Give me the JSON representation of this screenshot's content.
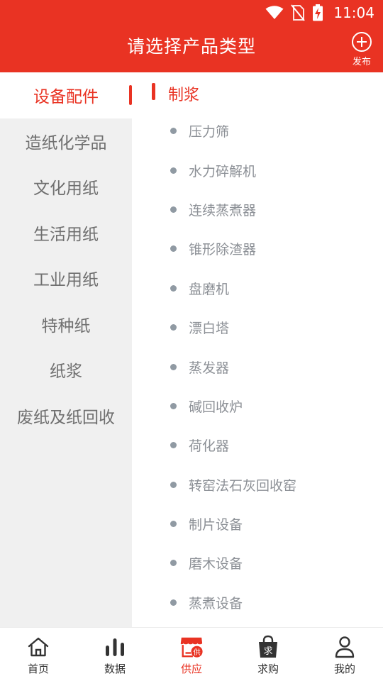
{
  "status_bar": {
    "time": "11:04"
  },
  "header": {
    "title": "请选择产品类型",
    "publish_label": "发布"
  },
  "categories": [
    {
      "label": "设备配件",
      "active": true
    },
    {
      "label": "造纸化学品"
    },
    {
      "label": "文化用纸"
    },
    {
      "label": "生活用纸"
    },
    {
      "label": "工业用纸"
    },
    {
      "label": "特种纸"
    },
    {
      "label": "纸浆"
    },
    {
      "label": "废纸及纸回收"
    }
  ],
  "section": {
    "title": "制浆",
    "items": [
      "压力筛",
      "水力碎解机",
      "连续蒸煮器",
      "锥形除渣器",
      "盘磨机",
      "漂白塔",
      "蒸发器",
      "碱回收炉",
      "荷化器",
      "转窑法石灰回收窑",
      "制片设备",
      "磨木设备",
      "蒸煮设备"
    ]
  },
  "bottom_nav": [
    {
      "label": "首页",
      "icon": "home-icon"
    },
    {
      "label": "数据",
      "icon": "bar-chart-icon"
    },
    {
      "label": "供应",
      "icon": "supply-store-icon",
      "badge": "供",
      "active": true
    },
    {
      "label": "求购",
      "icon": "purchase-bag-icon",
      "badge": "求"
    },
    {
      "label": "我的",
      "icon": "user-icon"
    }
  ],
  "colors": {
    "accent": "#e93323",
    "sidebar_bg": "#f0f0f0",
    "muted_text": "#8c9096"
  }
}
